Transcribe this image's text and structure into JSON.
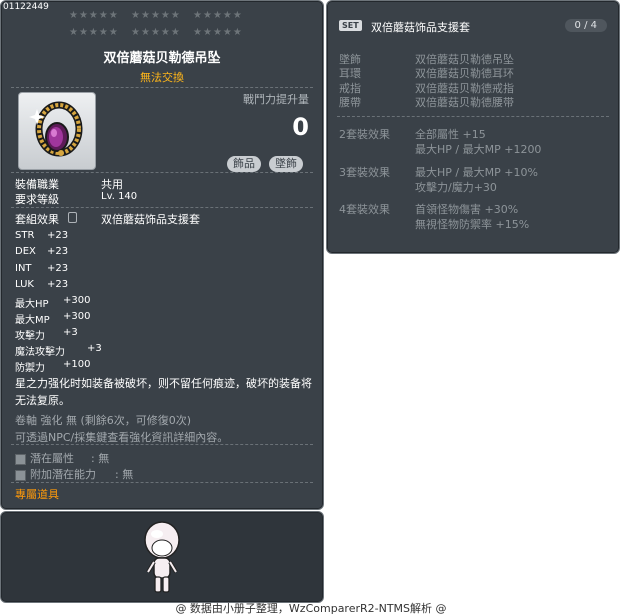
{
  "item": {
    "id": "01122449",
    "name": "双倍蘑菇贝勒德吊坠",
    "trade": "無法交換",
    "icon": "pendant-icon",
    "combat_label": "戰鬥力提升量",
    "combat_value": "0",
    "tags": [
      "飾品",
      "墜飾"
    ],
    "job_label": "裝備職業",
    "job_value": "共用",
    "level_label": "要求等級",
    "level_value": "Lv. 140",
    "set_effect_label": "套組效果",
    "set_effect_value": "双倍蘑菇饰品支援套",
    "stats": [
      {
        "name": "STR",
        "value": "+23"
      },
      {
        "name": "DEX",
        "value": "+23"
      },
      {
        "name": "INT",
        "value": "+23"
      },
      {
        "name": "LUK",
        "value": "+23"
      },
      {
        "name": "最大HP",
        "value": "+300"
      },
      {
        "name": "最大MP",
        "value": "+300"
      },
      {
        "name": "攻擊力",
        "value": "+3"
      },
      {
        "name": "魔法攻擊力",
        "value": "+3"
      },
      {
        "name": "防禦力",
        "value": "+100"
      }
    ],
    "description": "星之力强化时如装备被破坏，则不留任何痕迹，破坏的装备将无法复原。",
    "scroll_line": "卷軸 強化 無 (剩餘6次，可修復0次)",
    "hint_line": "可透過NPC/採集鍵查看強化資訊詳細內容。",
    "potential_label": "潛在屬性",
    "potential_value": ": 無",
    "bonus_potential_label": "附加潛在能力",
    "bonus_potential_value": ": 無",
    "exclusive": "專屬道具",
    "star_rows": [
      [
        "★★★★★",
        "★★★★★",
        "★★★★★"
      ],
      [
        "★★★★★",
        "★★★★★",
        "★★★★★"
      ]
    ]
  },
  "set": {
    "badge": "SET",
    "name": "双倍蘑菇饰品支援套",
    "count": "0 / 4",
    "parts": [
      {
        "slot": "墜飾",
        "item": "双倍蘑菇贝勒德吊坠"
      },
      {
        "slot": "耳環",
        "item": "双倍蘑菇贝勒德耳环"
      },
      {
        "slot": "戒指",
        "item": "双倍蘑菇贝勒德戒指"
      },
      {
        "slot": "腰帶",
        "item": "双倍蘑菇贝勒德腰带"
      }
    ],
    "effects": [
      {
        "label": "2套裝效果",
        "lines": [
          "全部屬性 +15",
          "最大HP / 最大MP +1200"
        ]
      },
      {
        "label": "3套裝效果",
        "lines": [
          "最大HP / 最大MP +10%",
          "攻擊力/魔力+30"
        ]
      },
      {
        "label": "4套裝效果",
        "lines": [
          "首領怪物傷害 +30%",
          "無視怪物防禦率 +15%"
        ]
      }
    ]
  },
  "footer": "@ 数据由小册子整理，WzComparerR2-NTMS解析 @"
}
